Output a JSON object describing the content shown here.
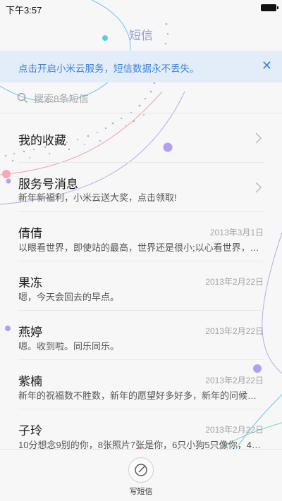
{
  "status": {
    "time": "下午3:57"
  },
  "header": {
    "title": "短信"
  },
  "banner": {
    "text": "点击开启小米云服务，短信数据永不丢失。",
    "close": "✕"
  },
  "search": {
    "placeholder": "搜索8条短信"
  },
  "messages": [
    {
      "name": "我的收藏",
      "preview": "",
      "date": ""
    },
    {
      "name": "服务号消息",
      "preview": "新年新福利，小米云送大奖，点击领取!",
      "date": ""
    },
    {
      "name": "倩倩",
      "preview": "以眼看世界，即使站的最高，世界还是很小;以心看世界，…",
      "date": "2013年3月1日"
    },
    {
      "name": "果冻",
      "preview": "嗯，今天会回去的早点。",
      "date": "2013年2月22日"
    },
    {
      "name": "燕婷",
      "preview": "嗯。收到啦。同乐同乐。",
      "date": "2013年2月22日"
    },
    {
      "name": "紫楠",
      "preview": "新年的祝福数不胜数，新年的愿望好多好多，新年的问候…",
      "date": "2013年2月22日"
    },
    {
      "name": "子玲",
      "preview": "10分想念9别的你，8张照片7张是你，6只小狗5只像你，4…",
      "date": "2013年2月22日"
    }
  ],
  "bottom": {
    "compose_label": "写短信"
  },
  "colors": {
    "accent": "#3f85d6",
    "title": "#8f9be6",
    "banner_bg": "#e3edf9"
  }
}
